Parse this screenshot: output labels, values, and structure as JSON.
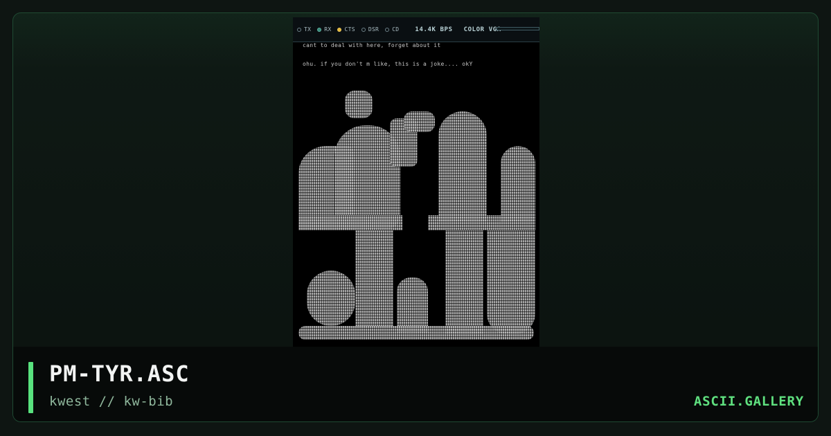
{
  "terminal": {
    "indicators": [
      {
        "label": "TX",
        "state": "off"
      },
      {
        "label": "RX",
        "state": "on-green"
      },
      {
        "label": "CTS",
        "state": "on-amber"
      },
      {
        "label": "DSR",
        "state": "off"
      },
      {
        "label": "CD",
        "state": "off"
      }
    ],
    "baud_rate": "14.4K BPS",
    "color_mode": "COLOR VGA",
    "transfer_progress": 0.0,
    "lines": [
      "cant to deal with here, forget about it",
      "ohu. if you don't m like, this is a joke.... okY"
    ]
  },
  "footer": {
    "title": "PM-TYR.ASC",
    "subtitle": "kwest // kw-bib",
    "brand": "ASCII.GALLERY"
  },
  "colors": {
    "accent": "#58e27e",
    "brand": "#5fe07f",
    "subtitle": "#8fb79c",
    "border": "#1f4a33"
  }
}
